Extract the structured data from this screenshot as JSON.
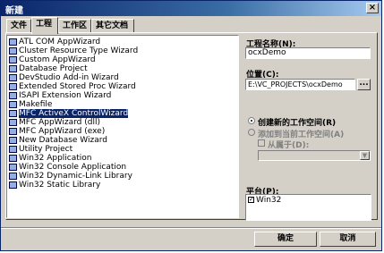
{
  "window": {
    "title": "新建",
    "close_glyph": "×"
  },
  "tabs": [
    {
      "label": "文件"
    },
    {
      "label": "工程"
    },
    {
      "label": "工作区"
    },
    {
      "label": "其它文档"
    }
  ],
  "project_types": [
    {
      "label": "ATL COM AppWizard",
      "selected": false
    },
    {
      "label": "Cluster Resource Type Wizard",
      "selected": false
    },
    {
      "label": "Custom AppWizard",
      "selected": false
    },
    {
      "label": "Database Project",
      "selected": false
    },
    {
      "label": "DevStudio Add-in Wizard",
      "selected": false
    },
    {
      "label": "Extended Stored Proc Wizard",
      "selected": false
    },
    {
      "label": "ISAPI Extension Wizard",
      "selected": false
    },
    {
      "label": "Makefile",
      "selected": false
    },
    {
      "label": "MFC ActiveX ControlWizard",
      "selected": true
    },
    {
      "label": "MFC AppWizard (dll)",
      "selected": false
    },
    {
      "label": "MFC AppWizard (exe)",
      "selected": false
    },
    {
      "label": "New Database Wizard",
      "selected": false
    },
    {
      "label": "Utility Project",
      "selected": false
    },
    {
      "label": "Win32 Application",
      "selected": false
    },
    {
      "label": "Win32 Console Application",
      "selected": false
    },
    {
      "label": "Win32 Dynamic-Link Library",
      "selected": false
    },
    {
      "label": "Win32 Static Library",
      "selected": false
    }
  ],
  "project_name": {
    "label": "工程名称(N):",
    "value": "ocxDemo"
  },
  "location": {
    "label": "位置(C):",
    "value": "E:\\VC_PROJECTS\\ocxDemo",
    "browse_label": "..."
  },
  "workspace": {
    "create_new": "创建新的工作空间(R)",
    "add_to_current": "添加到当前工作空间(A)",
    "dependency": "从属于(D):"
  },
  "platform": {
    "label": "平台(P):",
    "item": "Win32",
    "checked": true
  },
  "buttons": {
    "ok": "确定",
    "cancel": "取消"
  }
}
